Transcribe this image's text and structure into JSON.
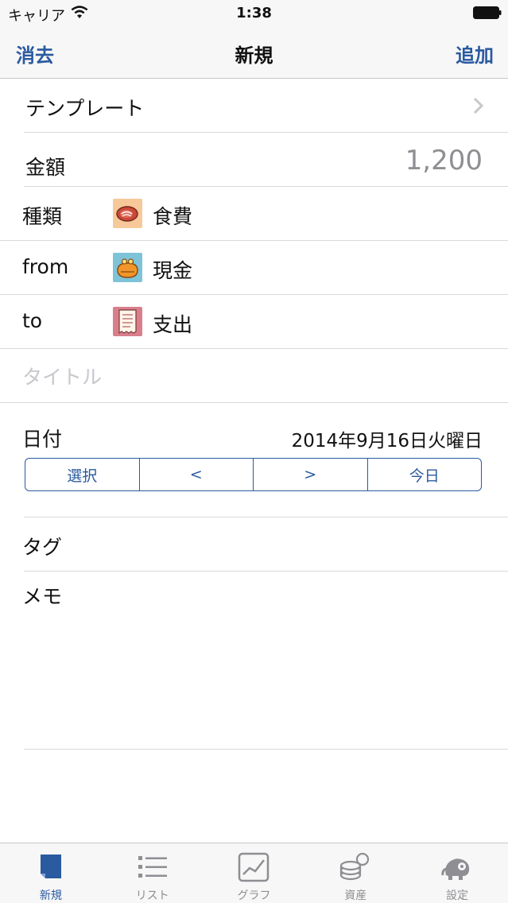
{
  "status_bar": {
    "carrier": "キャリア",
    "time": "1:38"
  },
  "nav": {
    "left_label": "消去",
    "title": "新規",
    "right_label": "追加"
  },
  "form": {
    "template_label": "テンプレート",
    "amount_label": "金額",
    "amount_value": "1,200",
    "type_label": "種類",
    "type_value": "食費",
    "type_icon": "meat-icon",
    "from_label": "from",
    "from_value": "現金",
    "from_icon": "coin-purse-icon",
    "to_label": "to",
    "to_value": "支出",
    "to_icon": "receipt-icon",
    "title_placeholder": "タイトル",
    "date_label": "日付",
    "date_value": "2014年9月16日火曜日",
    "date_buttons": [
      "選択",
      "<",
      ">",
      "今日"
    ],
    "tag_label": "タグ",
    "memo_label": "メモ"
  },
  "tab_bar": {
    "active": "新規",
    "items": [
      {
        "label": "新規",
        "icon": "new-entry-icon"
      },
      {
        "label": "リスト",
        "icon": "list-icon"
      },
      {
        "label": "グラフ",
        "icon": "chart-icon"
      },
      {
        "label": "資産",
        "icon": "coins-icon"
      },
      {
        "label": "設定",
        "icon": "elephant-gear-icon"
      }
    ]
  },
  "colors": {
    "accent": "#2a5aa0",
    "placeholder": "#c7c7cd",
    "tab_inactive": "#8e8e93",
    "separator": "#d9d9dd"
  }
}
